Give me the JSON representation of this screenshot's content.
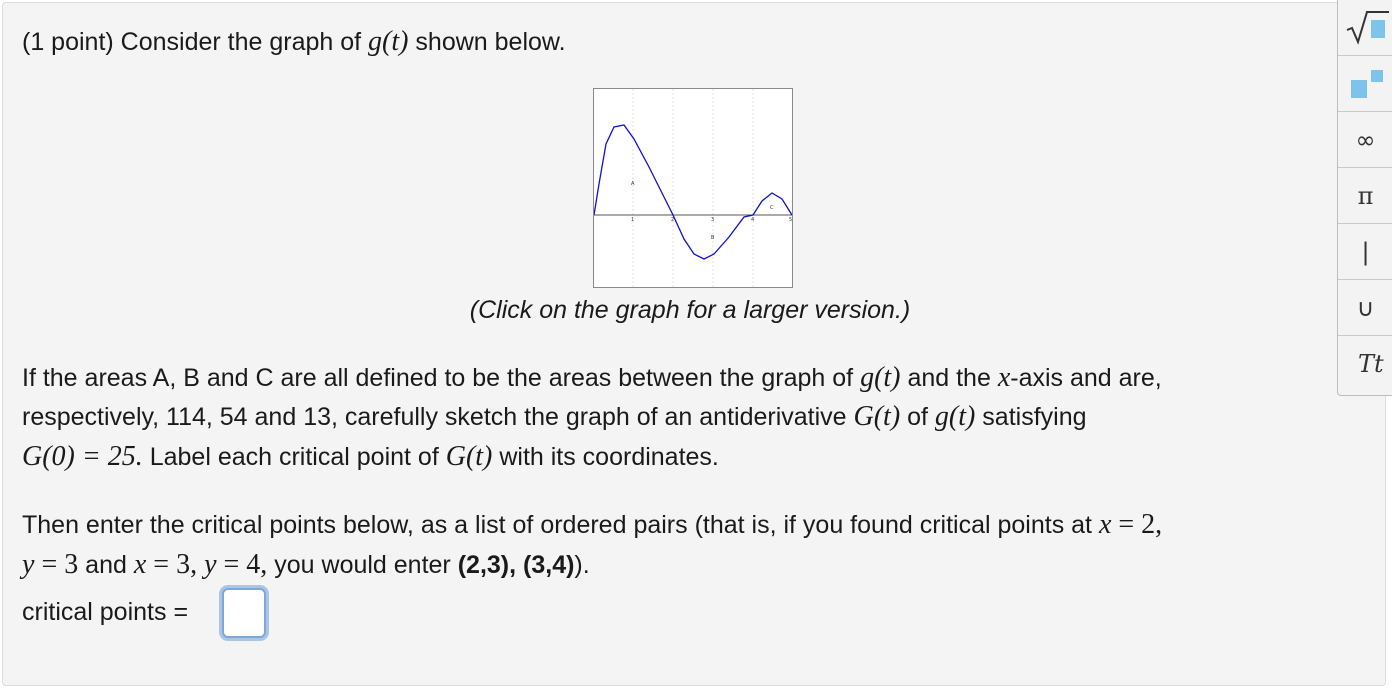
{
  "problem": {
    "intro_prefix": "(1 point) Consider the graph of ",
    "g_func": "g(t)",
    "intro_suffix": " shown below.",
    "caption": "(Click on the graph for a larger version.)",
    "para1_a": "If the areas A, B and C are all defined to be the areas between the graph of ",
    "para1_g": "g(t)",
    "para1_b": " and the ",
    "para1_x": "x",
    "para1_c": "-axis and are,",
    "para2_a": "respectively, 114, 54 and 13, carefully sketch the graph of an antiderivative ",
    "para2_G": "G(t)",
    "para2_b": " of ",
    "para2_g": "g(t)",
    "para2_c": " satisfying",
    "para3_G0": "G(0) = 25.",
    "para3_a": " Label each critical point of ",
    "para3_G": "G(t)",
    "para3_b": " with its coordinates.",
    "para4_a": "Then enter the critical points below, as a list of ordered pairs (that is, if you found critical points at ",
    "para4_x": "x",
    "para4_eq1": " = 2,",
    "para5_y": "y",
    "para5_eq1": " = 3",
    "para5_and": " and ",
    "para5_x": "x",
    "para5_eq2": " = 3, ",
    "para5_y2": "y",
    "para5_eq3": " = 4,",
    "para5_b": " you would enter ",
    "para5_example": "(2,3), (3,4)",
    "para5_c": ").",
    "answer_label": "critical points =",
    "answer_value": ""
  },
  "graph": {
    "tick_labels": [
      "1",
      "2",
      "3",
      "4",
      "5"
    ],
    "region_labels": [
      "A",
      "B",
      "C"
    ],
    "curve_color": "#1010d0"
  },
  "toolbar": {
    "buttons": [
      {
        "name": "sqrt-icon",
        "glyph": "√"
      },
      {
        "name": "exponent-icon",
        "glyph": ""
      },
      {
        "name": "infinity-icon",
        "glyph": "∞"
      },
      {
        "name": "pi-icon",
        "glyph": "π"
      },
      {
        "name": "bar-icon",
        "glyph": "|"
      },
      {
        "name": "union-icon",
        "glyph": "∪"
      },
      {
        "name": "text-icon",
        "glyph": "Tt"
      }
    ]
  }
}
